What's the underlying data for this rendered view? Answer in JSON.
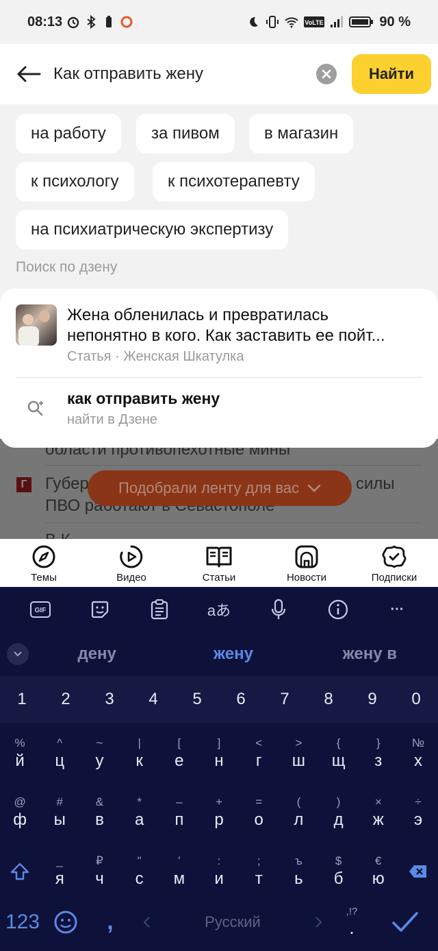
{
  "status_bar": {
    "time": "08:13",
    "battery": "90 %"
  },
  "search": {
    "query": "Как отправить жену",
    "clear_icon": "clear-icon",
    "find_label": "Найти"
  },
  "suggestion_chips": [
    "на работу",
    "за пивом",
    "в магазин",
    "к психологу",
    "к психотерапевту",
    "на психиатрическую экспертизу"
  ],
  "section_label": "Поиск по дзену",
  "article_result": {
    "title_line1": "Жена обленилась и превратилась",
    "title_line2": "непонятно в кого. Как заставить ее пойт...",
    "meta": "Статья · Женская  Шкатулка"
  },
  "query_result": {
    "title": "как отправить жену",
    "subtitle": "найти в Дзене"
  },
  "feed": {
    "line1": "области противопехотные мины",
    "line2a": "Губер",
    "line2b": "силы",
    "line3": "ПВО работают в Севастополе",
    "line4": "В К",
    "logo_letter": "Г",
    "pill_label": "Подобрали ленту для вас"
  },
  "bottom_nav": [
    {
      "label": "Темы",
      "icon": "compass-icon"
    },
    {
      "label": "Видео",
      "icon": "play-icon"
    },
    {
      "label": "Статьи",
      "icon": "book-icon"
    },
    {
      "label": "Новости",
      "icon": "news-icon"
    },
    {
      "label": "Подписки",
      "icon": "subscriptions-icon"
    }
  ],
  "keyboard": {
    "toolbar": {
      "gif": "GIF",
      "translate": "aあ",
      "more": "···"
    },
    "suggestions": [
      "дену",
      "жену",
      "жену в"
    ],
    "number_row": [
      "1",
      "2",
      "3",
      "4",
      "5",
      "6",
      "7",
      "8",
      "9",
      "0"
    ],
    "row1": [
      {
        "alt": "%",
        "main": "й"
      },
      {
        "alt": "^",
        "main": "ц"
      },
      {
        "alt": "~",
        "main": "у"
      },
      {
        "alt": "|",
        "main": "к"
      },
      {
        "alt": "[",
        "main": "е"
      },
      {
        "alt": "]",
        "main": "н"
      },
      {
        "alt": "<",
        "main": "г"
      },
      {
        "alt": ">",
        "main": "ш"
      },
      {
        "alt": "{",
        "main": "щ"
      },
      {
        "alt": "}",
        "main": "з"
      },
      {
        "alt": "№",
        "main": "х"
      }
    ],
    "row2": [
      {
        "alt": "@",
        "main": "ф"
      },
      {
        "alt": "#",
        "main": "ы"
      },
      {
        "alt": "&",
        "main": "в"
      },
      {
        "alt": "*",
        "main": "а"
      },
      {
        "alt": "–",
        "main": "п"
      },
      {
        "alt": "+",
        "main": "р"
      },
      {
        "alt": "=",
        "main": "о"
      },
      {
        "alt": "(",
        "main": "л"
      },
      {
        "alt": ")",
        "main": "д"
      },
      {
        "alt": "×",
        "main": "ж"
      },
      {
        "alt": "÷",
        "main": "э"
      }
    ],
    "row3": [
      {
        "alt": "_",
        "main": "я"
      },
      {
        "alt": "₽",
        "main": "ч"
      },
      {
        "alt": "\"",
        "main": "с"
      },
      {
        "alt": "'",
        "main": "м"
      },
      {
        "alt": ":",
        "main": "и"
      },
      {
        "alt": ";",
        "main": "т"
      },
      {
        "alt": "ъ",
        "main": "ь"
      },
      {
        "alt": "$",
        "main": "б"
      },
      {
        "alt": "€",
        "main": "ю"
      }
    ],
    "bottom": {
      "symbols": "123",
      "comma": ",",
      "space": "Русский",
      "period_alt": ",!?",
      "period": "."
    }
  },
  "colors": {
    "accent_yellow": "#fcd02f",
    "keyboard_bg": "#0e1139",
    "keyboard_highlight": "#5a8ae6",
    "pill": "#8a3518"
  }
}
